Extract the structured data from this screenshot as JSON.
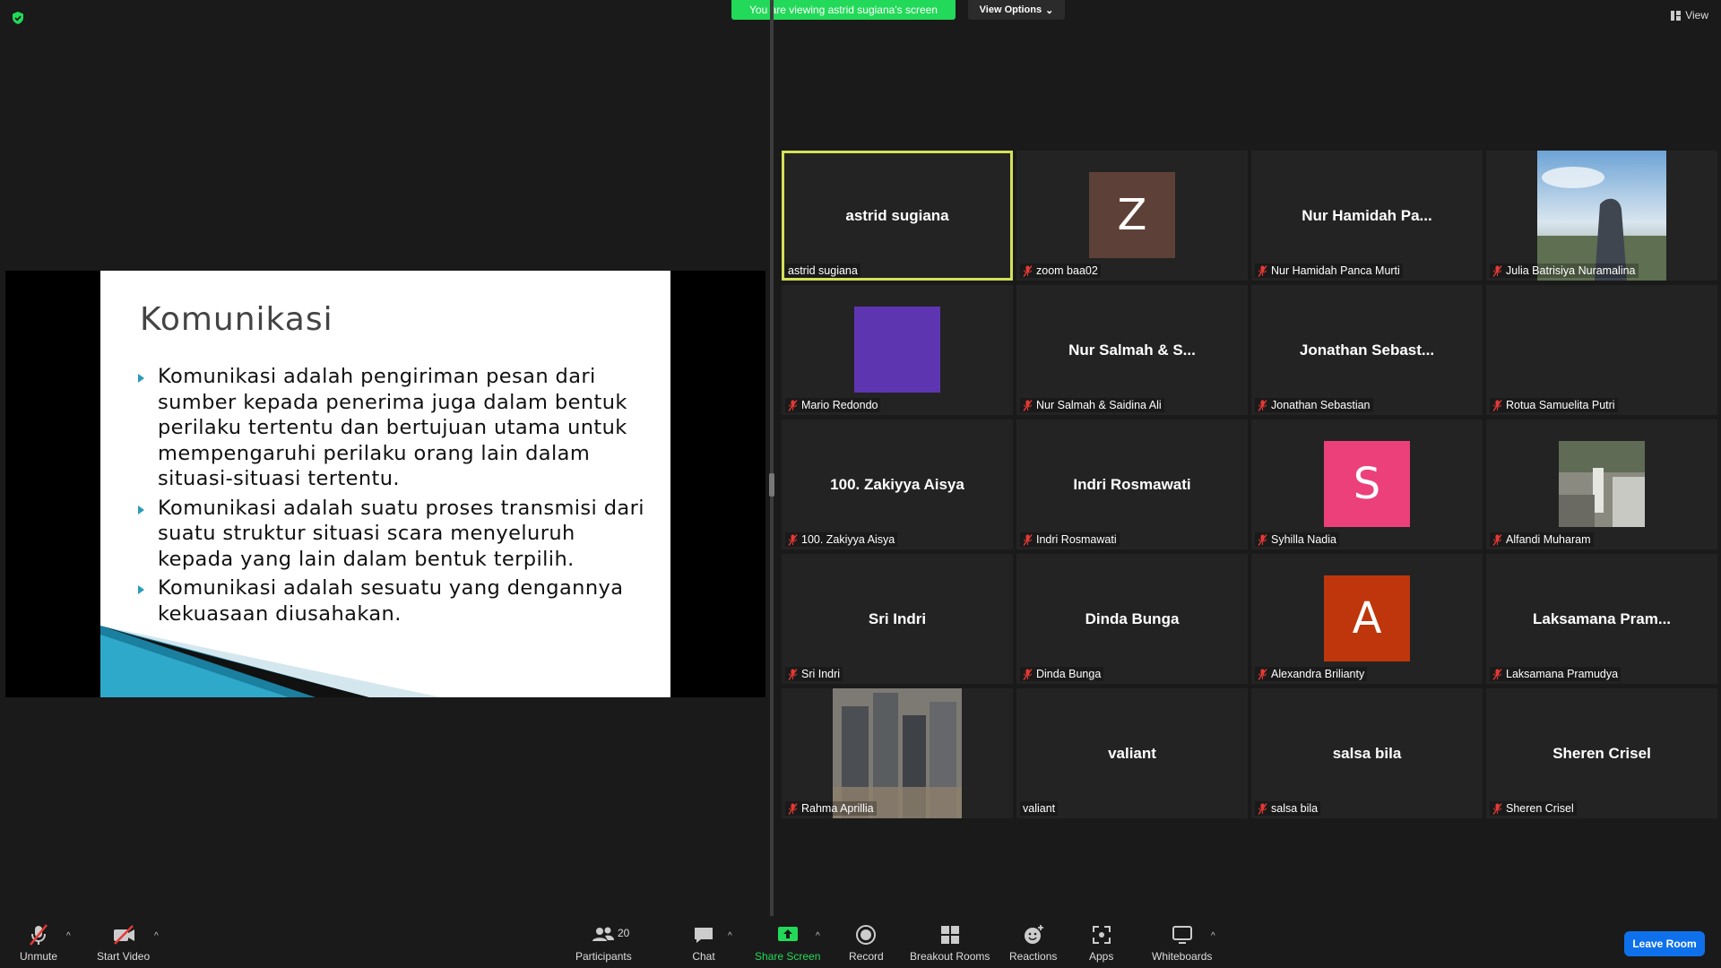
{
  "banner": {
    "text": "You are viewing astrid sugiana's screen"
  },
  "view_options": {
    "label": "View Options"
  },
  "view_button": {
    "label": "View"
  },
  "slide": {
    "title": "Komunikasi",
    "bullets": [
      "Komunikasi adalah pengiriman pesan dari sumber kepada penerima juga dalam bentuk perilaku tertentu dan bertujuan utama untuk mempengaruhi perilaku orang lain dalam situasi-situasi tertentu.",
      "Komunikasi adalah suatu proses transmisi dari suatu struktur situasi scara menyeluruh kepada yang lain dalam bentuk terpilih.",
      "Komunikasi adalah sesuatu yang dengannya kekuasaan diusahakan."
    ]
  },
  "participants": [
    {
      "display": "astrid sugiana",
      "label": "astrid sugiana",
      "muted": false,
      "active": true
    },
    {
      "avatar_letter": "Z",
      "avatar_color": "#5d4037",
      "label": "zoom baa02",
      "muted": true
    },
    {
      "display": "Nur Hamidah Pa...",
      "label": "Nur Hamidah Panca Murti",
      "muted": true
    },
    {
      "photo": "landscape",
      "label": "Julia Batrisiya Nuramalina",
      "muted": true
    },
    {
      "avatar_color": "#5e35b1",
      "label": "Mario Redondo",
      "muted": true
    },
    {
      "display": "Nur Salmah & S...",
      "label": "Nur Salmah & Saidina Ali",
      "muted": true
    },
    {
      "display": "Jonathan Sebast...",
      "label": "Jonathan Sebastian",
      "muted": true
    },
    {
      "label": "Rotua Samuelita Putri",
      "muted": true
    },
    {
      "display": "100. Zakiyya Aisya",
      "label": "100. Zakiyya Aisya",
      "muted": true
    },
    {
      "display": "Indri Rosmawati",
      "label": "Indri Rosmawati",
      "muted": true
    },
    {
      "avatar_letter": "S",
      "avatar_color": "#ec407a",
      "label": "Syhilla Nadia",
      "muted": true
    },
    {
      "photo": "street",
      "label": "Alfandi Muharam",
      "muted": true
    },
    {
      "display": "Sri Indri",
      "label": "Sri Indri",
      "muted": true
    },
    {
      "display": "Dinda Bunga",
      "label": "Dinda Bunga",
      "muted": true
    },
    {
      "avatar_letter": "A",
      "avatar_color": "#bf360c",
      "label": "Alexandra Brilianty",
      "muted": true
    },
    {
      "display": "Laksamana  Pram...",
      "label": "Laksamana Pramudya",
      "muted": true
    },
    {
      "photo": "city",
      "label": "Rahma Aprillia",
      "muted": true
    },
    {
      "display": "valiant",
      "label": "valiant",
      "muted": false
    },
    {
      "display": "salsa bila",
      "label": "salsa bila",
      "muted": true
    },
    {
      "display": "Sheren Crisel",
      "label": "Sheren Crisel",
      "muted": true
    }
  ],
  "toolbar": {
    "unmute": "Unmute",
    "start_video": "Start Video",
    "participants": "Participants",
    "participants_count": "20",
    "chat": "Chat",
    "share_screen": "Share Screen",
    "record": "Record",
    "breakout_rooms": "Breakout Rooms",
    "reactions": "Reactions",
    "apps": "Apps",
    "whiteboards": "Whiteboards",
    "leave": "Leave Room"
  },
  "colors": {
    "share_green": "#23d959",
    "active_border": "#d4e157",
    "leave_blue": "#0e71eb"
  }
}
